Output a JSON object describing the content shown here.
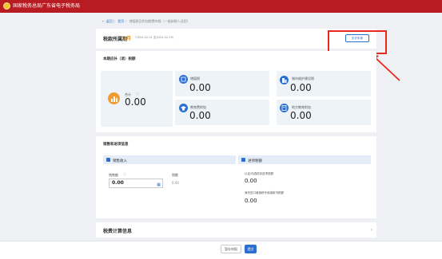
{
  "app": {
    "title": "国家税务总局广东省电子税务局"
  },
  "breadcrumb": {
    "back": "返回",
    "home": "首页",
    "current": "增值税及附加税费申报（一般纳税人适用）"
  },
  "header": {
    "period_label": "税款所属期",
    "period_value": "2月",
    "date_range": "（2024-02-01 至2024-02-29）",
    "prev_button": "历史申报"
  },
  "tax_section": {
    "title": "本期应补（退）税额",
    "total": {
      "label": "合计",
      "value": "0.00"
    },
    "items": [
      {
        "label": "增值税",
        "value": "0.00"
      },
      {
        "label": "城市维护建设税",
        "value": "0.00"
      },
      {
        "label": "教育费附加",
        "value": "0.00"
      },
      {
        "label": "地方教育附加",
        "value": "0.00"
      }
    ]
  },
  "sales_section": {
    "title": "销售和进项信息",
    "sales": {
      "header": "销售收入",
      "field_label": "销售额",
      "field_value": "0.00",
      "tax_label": "税额",
      "tax_value": "0.00"
    },
    "input": {
      "header": "进项税额",
      "line1_label": "认证/勾选抵扣进项税额",
      "line1_value": "0.00",
      "line2_label": "海关进口增值税专用缴款书税额",
      "line2_value": "0.00"
    }
  },
  "calc_section": {
    "title": "税费计算信息"
  },
  "footer": {
    "save": "暂存申报",
    "submit": "提交"
  },
  "colors": {
    "brand_red": "#b81c22",
    "primary": "#2c6fd1",
    "orange": "#e7920c",
    "highlight": "#e8281e"
  }
}
